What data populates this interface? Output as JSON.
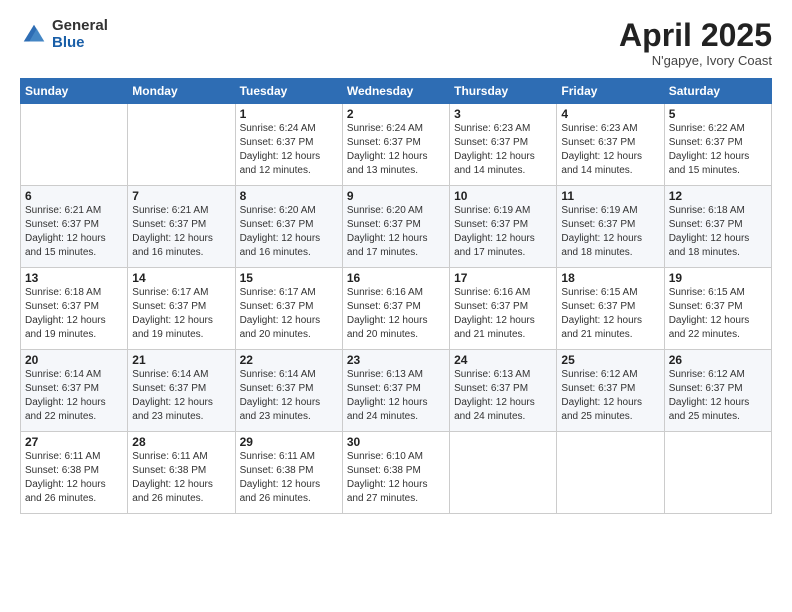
{
  "logo": {
    "general": "General",
    "blue": "Blue"
  },
  "title": "April 2025",
  "location": "N'gapye, Ivory Coast",
  "days_of_week": [
    "Sunday",
    "Monday",
    "Tuesday",
    "Wednesday",
    "Thursday",
    "Friday",
    "Saturday"
  ],
  "weeks": [
    [
      {
        "day": "",
        "info": ""
      },
      {
        "day": "",
        "info": ""
      },
      {
        "day": "1",
        "info": "Sunrise: 6:24 AM\nSunset: 6:37 PM\nDaylight: 12 hours and 12 minutes."
      },
      {
        "day": "2",
        "info": "Sunrise: 6:24 AM\nSunset: 6:37 PM\nDaylight: 12 hours and 13 minutes."
      },
      {
        "day": "3",
        "info": "Sunrise: 6:23 AM\nSunset: 6:37 PM\nDaylight: 12 hours and 14 minutes."
      },
      {
        "day": "4",
        "info": "Sunrise: 6:23 AM\nSunset: 6:37 PM\nDaylight: 12 hours and 14 minutes."
      },
      {
        "day": "5",
        "info": "Sunrise: 6:22 AM\nSunset: 6:37 PM\nDaylight: 12 hours and 15 minutes."
      }
    ],
    [
      {
        "day": "6",
        "info": "Sunrise: 6:21 AM\nSunset: 6:37 PM\nDaylight: 12 hours and 15 minutes."
      },
      {
        "day": "7",
        "info": "Sunrise: 6:21 AM\nSunset: 6:37 PM\nDaylight: 12 hours and 16 minutes."
      },
      {
        "day": "8",
        "info": "Sunrise: 6:20 AM\nSunset: 6:37 PM\nDaylight: 12 hours and 16 minutes."
      },
      {
        "day": "9",
        "info": "Sunrise: 6:20 AM\nSunset: 6:37 PM\nDaylight: 12 hours and 17 minutes."
      },
      {
        "day": "10",
        "info": "Sunrise: 6:19 AM\nSunset: 6:37 PM\nDaylight: 12 hours and 17 minutes."
      },
      {
        "day": "11",
        "info": "Sunrise: 6:19 AM\nSunset: 6:37 PM\nDaylight: 12 hours and 18 minutes."
      },
      {
        "day": "12",
        "info": "Sunrise: 6:18 AM\nSunset: 6:37 PM\nDaylight: 12 hours and 18 minutes."
      }
    ],
    [
      {
        "day": "13",
        "info": "Sunrise: 6:18 AM\nSunset: 6:37 PM\nDaylight: 12 hours and 19 minutes."
      },
      {
        "day": "14",
        "info": "Sunrise: 6:17 AM\nSunset: 6:37 PM\nDaylight: 12 hours and 19 minutes."
      },
      {
        "day": "15",
        "info": "Sunrise: 6:17 AM\nSunset: 6:37 PM\nDaylight: 12 hours and 20 minutes."
      },
      {
        "day": "16",
        "info": "Sunrise: 6:16 AM\nSunset: 6:37 PM\nDaylight: 12 hours and 20 minutes."
      },
      {
        "day": "17",
        "info": "Sunrise: 6:16 AM\nSunset: 6:37 PM\nDaylight: 12 hours and 21 minutes."
      },
      {
        "day": "18",
        "info": "Sunrise: 6:15 AM\nSunset: 6:37 PM\nDaylight: 12 hours and 21 minutes."
      },
      {
        "day": "19",
        "info": "Sunrise: 6:15 AM\nSunset: 6:37 PM\nDaylight: 12 hours and 22 minutes."
      }
    ],
    [
      {
        "day": "20",
        "info": "Sunrise: 6:14 AM\nSunset: 6:37 PM\nDaylight: 12 hours and 22 minutes."
      },
      {
        "day": "21",
        "info": "Sunrise: 6:14 AM\nSunset: 6:37 PM\nDaylight: 12 hours and 23 minutes."
      },
      {
        "day": "22",
        "info": "Sunrise: 6:14 AM\nSunset: 6:37 PM\nDaylight: 12 hours and 23 minutes."
      },
      {
        "day": "23",
        "info": "Sunrise: 6:13 AM\nSunset: 6:37 PM\nDaylight: 12 hours and 24 minutes."
      },
      {
        "day": "24",
        "info": "Sunrise: 6:13 AM\nSunset: 6:37 PM\nDaylight: 12 hours and 24 minutes."
      },
      {
        "day": "25",
        "info": "Sunrise: 6:12 AM\nSunset: 6:37 PM\nDaylight: 12 hours and 25 minutes."
      },
      {
        "day": "26",
        "info": "Sunrise: 6:12 AM\nSunset: 6:37 PM\nDaylight: 12 hours and 25 minutes."
      }
    ],
    [
      {
        "day": "27",
        "info": "Sunrise: 6:11 AM\nSunset: 6:38 PM\nDaylight: 12 hours and 26 minutes."
      },
      {
        "day": "28",
        "info": "Sunrise: 6:11 AM\nSunset: 6:38 PM\nDaylight: 12 hours and 26 minutes."
      },
      {
        "day": "29",
        "info": "Sunrise: 6:11 AM\nSunset: 6:38 PM\nDaylight: 12 hours and 26 minutes."
      },
      {
        "day": "30",
        "info": "Sunrise: 6:10 AM\nSunset: 6:38 PM\nDaylight: 12 hours and 27 minutes."
      },
      {
        "day": "",
        "info": ""
      },
      {
        "day": "",
        "info": ""
      },
      {
        "day": "",
        "info": ""
      }
    ]
  ]
}
